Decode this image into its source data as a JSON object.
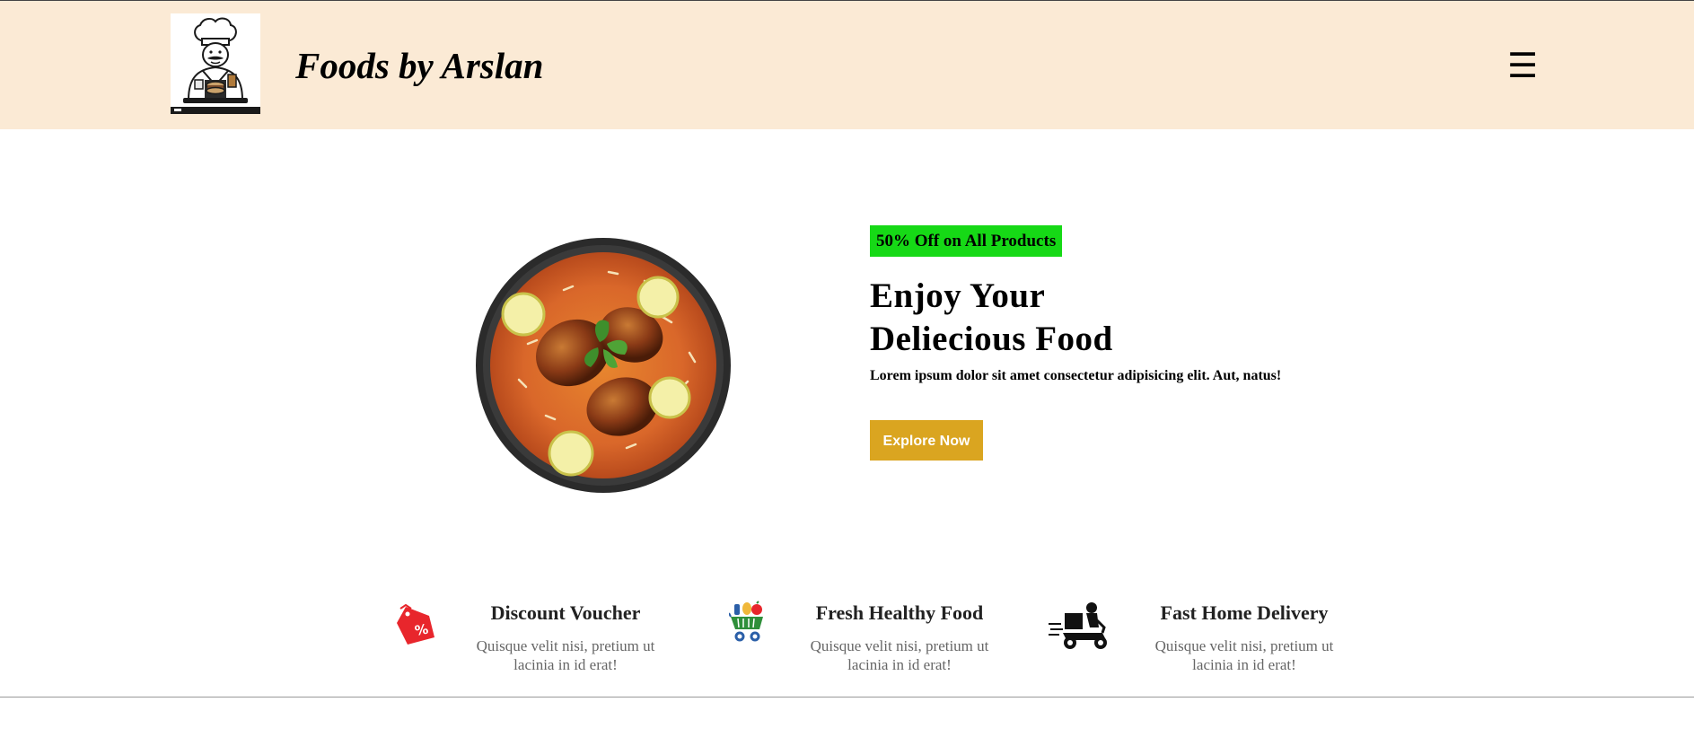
{
  "header": {
    "brand": "Foods by Arslan",
    "logo_alt": "Chef logo",
    "menu_glyph": "☰"
  },
  "hero": {
    "badge": "50% Off on All Products",
    "title_line1": "Enjoy Your",
    "title_line2": "Deliecious Food",
    "subtitle": "Lorem ipsum dolor sit amet consectetur adipisicing elit. Aut, natus!",
    "button_label": "Explore Now",
    "image": "chicken-biryani-plate"
  },
  "features": [
    {
      "title": "Discount Voucher",
      "desc_line1": "Quisque velit nisi, pretium ut",
      "desc_line2": "lacinia in id erat!",
      "icon": "discount-tag-icon"
    },
    {
      "title": "Fresh Healthy Food",
      "desc_line1": "Quisque velit nisi, pretium ut",
      "desc_line2": "lacinia in id erat!",
      "icon": "grocery-cart-icon"
    },
    {
      "title": "Fast Home Delivery",
      "desc_line1": "Quisque velit nisi, pretium ut",
      "desc_line2": "lacinia in id erat!",
      "icon": "delivery-scooter-icon"
    }
  ],
  "colors": {
    "header_bg": "#fbead5",
    "badge_bg": "#16d916",
    "button_bg": "#daa520",
    "discount_icon": "#e8262c",
    "cart_icon": "#2f8f3a"
  }
}
